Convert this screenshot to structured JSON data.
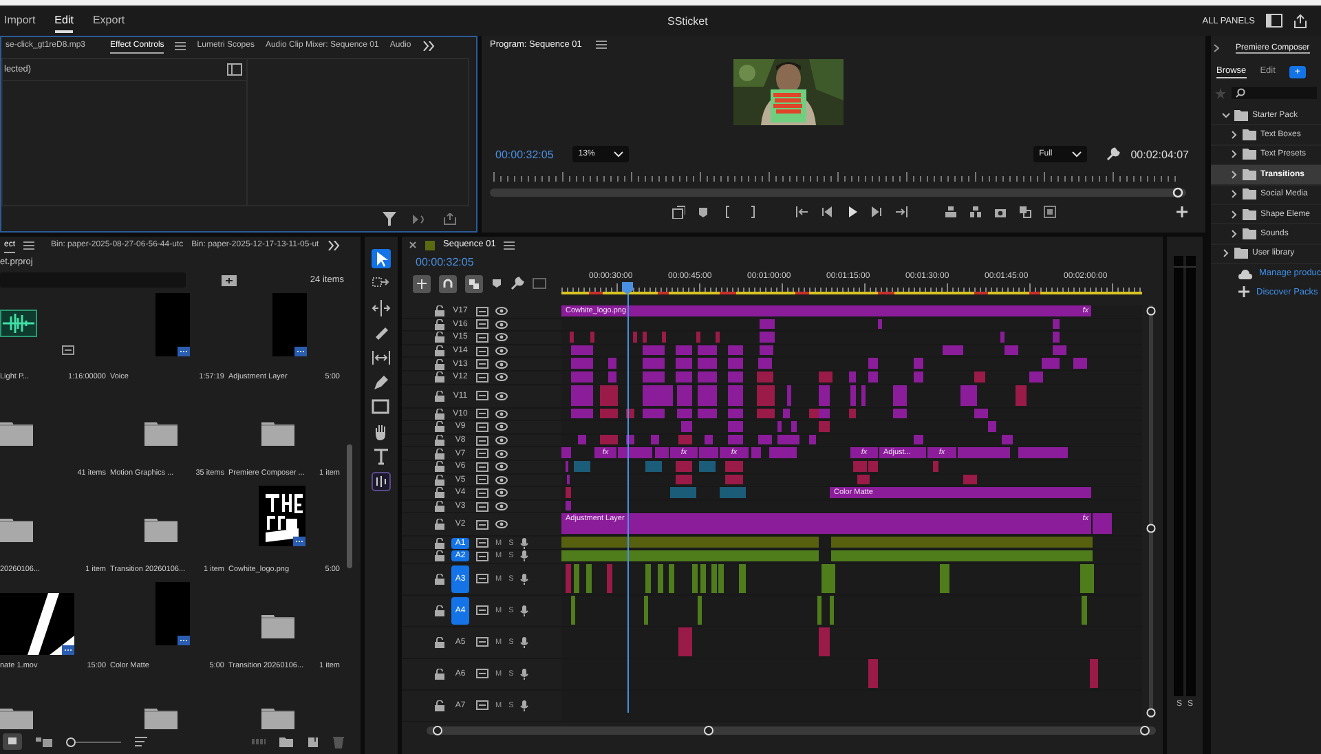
{
  "header": {
    "tabs": [
      {
        "label": "Import",
        "selected": false
      },
      {
        "label": "Edit",
        "selected": true
      },
      {
        "label": "Export",
        "selected": false
      }
    ],
    "title": "SSticket",
    "all_panels": "ALL PANELS"
  },
  "effect_panel": {
    "tabs": [
      {
        "label": "se-click_gt1reD8.mp3",
        "selected": false
      },
      {
        "label": "Effect Controls",
        "selected": true
      },
      {
        "label": "Lumetri Scopes",
        "selected": false
      },
      {
        "label": "Audio Clip Mixer: Sequence 01",
        "selected": false
      },
      {
        "label": "Audio",
        "selected": false
      }
    ],
    "clip_label": "lected)"
  },
  "program": {
    "title": "Program: Sequence 01",
    "timecode": "00:00:32:05",
    "zoom": "13%",
    "quality": "Full",
    "duration": "00:02:04:07"
  },
  "project": {
    "tabs": [
      {
        "label": "ect",
        "selected": true
      },
      {
        "label": "Bin: paper-2025-08-27-06-56-44-utc",
        "selected": false
      },
      {
        "label": "Bin: paper-2025-12-17-13-11-05-ut",
        "selected": false
      }
    ],
    "file": "et.prproj",
    "count": "24 items",
    "zoom_slider": {
      "level": 0
    },
    "items": [
      {
        "kind": "audio",
        "name": "Light P...",
        "info": "1:16:00000"
      },
      {
        "kind": "black",
        "name": "Voice",
        "info": "1:57:19"
      },
      {
        "kind": "black",
        "name": "Adjustment Layer",
        "info": "5:00"
      },
      {
        "kind": "folder",
        "info": "41 items"
      },
      {
        "kind": "folder",
        "name": "Motion Graphics ...",
        "info": "35 items"
      },
      {
        "kind": "folder",
        "name": "Premiere Composer ...",
        "info": "1 item"
      },
      {
        "kind": "folder",
        "name": "20260106...",
        "info": "1 item"
      },
      {
        "kind": "folder",
        "name": "Transition 20260106...",
        "info": "1 item"
      },
      {
        "kind": "logo",
        "name": "Cowhite_logo.png",
        "info": "5:00"
      },
      {
        "kind": "stroke",
        "name": "nate 1.mov",
        "info": "15:00"
      },
      {
        "kind": "black",
        "name": "Color Matte",
        "info": "5:00"
      },
      {
        "kind": "folder",
        "name": "Transition 20260106...",
        "info": "1 item"
      },
      {
        "kind": "folder"
      },
      {
        "kind": "folder"
      },
      {
        "kind": "folder"
      }
    ]
  },
  "timeline": {
    "title": "Sequence 01",
    "timecode": "00:00:32:05",
    "ruler": [
      "00:00:30:00",
      "00:00:45:00",
      "00:01:00:00",
      "00:01:15:00",
      "00:01:30:00",
      "00:01:45:00",
      "00:02:00:00"
    ],
    "tracks": [
      {
        "kind": "video",
        "name": "V17",
        "targeted": false,
        "expanded": false,
        "clips": [
          {
            "color": "#8b1d9a",
            "label": "Cowhite_logo.png",
            "badge": "fx"
          }
        ]
      },
      {
        "kind": "video",
        "name": "V16",
        "targeted": false,
        "expanded": false,
        "clips": [
          {
            "color": "#8b1d9a"
          },
          {
            "color": "#8b1d9a"
          },
          {
            "color": "#8b1d9a"
          }
        ]
      },
      {
        "kind": "video",
        "name": "V15",
        "targeted": false,
        "expanded": false,
        "clips": [
          {
            "color": "#9a1a48"
          },
          {
            "color": "#9a1a48"
          },
          {
            "color": "#9a1a48"
          },
          {
            "color": "#9a1a48"
          },
          {
            "color": "#9a1a48"
          },
          {
            "color": "#9a1a48"
          },
          {
            "color": "#9a1a48"
          },
          {
            "color": "#8b1d9a"
          },
          {
            "color": "#8b1d9a"
          },
          {
            "color": "#8b1d9a"
          }
        ]
      },
      {
        "kind": "video",
        "name": "V14",
        "targeted": false,
        "expanded": false,
        "clips": [
          {
            "color": "#8b1d9a"
          },
          {
            "color": "#8b1d9a"
          },
          {
            "color": "#8b1d9a"
          },
          {
            "color": "#8b1d9a"
          },
          {
            "color": "#8b1d9a"
          },
          {
            "color": "#8b1d9a"
          },
          {
            "color": "#8b1d9a"
          },
          {
            "color": "#8b1d9a"
          },
          {
            "color": "#8b1d9a"
          }
        ]
      },
      {
        "kind": "video",
        "name": "V13",
        "targeted": false,
        "expanded": false,
        "clips": [
          {
            "color": "#8b1d9a"
          },
          {
            "color": "#8b1d9a"
          },
          {
            "color": "#8b1d9a"
          },
          {
            "color": "#8b1d9a"
          },
          {
            "color": "#8b1d9a"
          },
          {
            "color": "#8b1d9a"
          },
          {
            "color": "#8b1d9a"
          },
          {
            "color": "#8b1d9a"
          },
          {
            "color": "#8b1d9a"
          },
          {
            "color": "#8b1d9a"
          },
          {
            "color": "#8b1d9a"
          }
        ]
      },
      {
        "kind": "video",
        "name": "V12",
        "targeted": false,
        "expanded": false,
        "clips": [
          {
            "color": "#8b1d9a"
          },
          {
            "color": "#8b1d9a"
          },
          {
            "color": "#8b1d9a"
          },
          {
            "color": "#8b1d9a"
          },
          {
            "color": "#8b1d9a"
          },
          {
            "color": "#8b1d9a"
          },
          {
            "color": "#9a1a48"
          },
          {
            "color": "#9a1a48"
          },
          {
            "color": "#8b1d9a"
          },
          {
            "color": "#8b1d9a"
          },
          {
            "color": "#8b1d9a"
          },
          {
            "color": "#9a1a48"
          },
          {
            "color": "#8b1d9a"
          }
        ]
      },
      {
        "kind": "video",
        "name": "V11",
        "targeted": false,
        "expanded": true,
        "clips": [
          {
            "color": "#8b1d9a"
          },
          {
            "color": "#9a1a48"
          },
          {
            "color": "#8b1d9a"
          },
          {
            "color": "#8b1d9a"
          },
          {
            "color": "#8b1d9a"
          },
          {
            "color": "#8b1d9a"
          },
          {
            "color": "#8b1d9a"
          },
          {
            "color": "#9a1a48"
          },
          {
            "color": "#8b1d9a"
          },
          {
            "color": "#8b1d9a"
          },
          {
            "color": "#8b1d9a"
          },
          {
            "color": "#8b1d9a"
          },
          {
            "color": "#8b1d9a"
          },
          {
            "color": "#8b1d9a"
          },
          {
            "color": "#9a1a48"
          }
        ]
      },
      {
        "kind": "video",
        "name": "V10",
        "targeted": false,
        "expanded": false,
        "clips": [
          {
            "color": "#8b1d9a"
          },
          {
            "color": "#9a1a48"
          },
          {
            "color": "#9a1a48"
          },
          {
            "color": "#8b1d9a"
          },
          {
            "color": "#8b1d9a"
          },
          {
            "color": "#8b1d9a"
          },
          {
            "color": "#8b1d9a"
          },
          {
            "color": "#9a1a48"
          },
          {
            "color": "#8b1d9a"
          },
          {
            "color": "#9a1a48"
          },
          {
            "color": "#8b1d9a"
          },
          {
            "color": "#9a1a48"
          },
          {
            "color": "#8b1d9a"
          },
          {
            "color": "#8b1d9a"
          }
        ]
      },
      {
        "kind": "video",
        "name": "V9",
        "targeted": false,
        "expanded": false,
        "clips": [
          {
            "color": "#8b1d9a"
          },
          {
            "color": "#8b1d9a"
          },
          {
            "color": "#8b1d9a"
          },
          {
            "color": "#8b1d9a"
          },
          {
            "color": "#9a1a48"
          },
          {
            "color": "#8b1d9a"
          }
        ]
      },
      {
        "kind": "video",
        "name": "V8",
        "targeted": false,
        "expanded": false,
        "clips": [
          {
            "color": "#8b1d9a"
          },
          {
            "color": "#9a1a48"
          },
          {
            "color": "#8b1d9a"
          },
          {
            "color": "#8b1d9a"
          },
          {
            "color": "#9a1a48"
          },
          {
            "color": "#8b1d9a"
          },
          {
            "color": "#8b1d9a"
          },
          {
            "color": "#8b1d9a"
          },
          {
            "color": "#8b1d9a"
          },
          {
            "color": "#8b1d9a"
          },
          {
            "color": "#8b1d9a"
          },
          {
            "color": "#8b1d9a"
          }
        ]
      },
      {
        "kind": "video",
        "name": "V7",
        "targeted": false,
        "expanded": false,
        "clips": [
          {
            "color": "#8b1d9a"
          },
          {
            "color": "#8b1d9a",
            "badge": "fx"
          },
          {
            "color": "#8b1d9a"
          },
          {
            "color": "#8b1d9a"
          },
          {
            "color": "#8b1d9a"
          },
          {
            "color": "#8b1d9a",
            "badge": "fx"
          },
          {
            "color": "#8b1d9a"
          },
          {
            "color": "#8b1d9a",
            "badge": "fx"
          },
          {
            "color": "#8b1d9a"
          },
          {
            "color": "#8b1d9a"
          },
          {
            "color": "#8b1d9a",
            "badge": "fx"
          },
          {
            "color": "#8b1d9a",
            "label": "Adjust..."
          },
          {
            "color": "#8b1d9a",
            "badge": "fx"
          },
          {
            "color": "#8b1d9a"
          },
          {
            "color": "#8b1d9a"
          }
        ]
      },
      {
        "kind": "video",
        "name": "V6",
        "targeted": false,
        "expanded": false,
        "clips": [
          {
            "color": "#8b1d9a"
          },
          {
            "color": "#1b5c78"
          },
          {
            "color": "#1b5c78"
          },
          {
            "color": "#9a1a48"
          },
          {
            "color": "#1b5c78"
          },
          {
            "color": "#9a1a48"
          },
          {
            "color": "#9a1a48"
          },
          {
            "color": "#9a1a48"
          },
          {
            "color": "#9a1a48"
          }
        ]
      },
      {
        "kind": "video",
        "name": "V5",
        "targeted": false,
        "expanded": false,
        "clips": [
          {
            "color": "#8b1d9a"
          },
          {
            "color": "#9a1a48"
          },
          {
            "color": "#9a1a48"
          },
          {
            "color": "#9a1a48"
          },
          {
            "color": "#9a1a48"
          }
        ]
      },
      {
        "kind": "video",
        "name": "V4",
        "targeted": false,
        "expanded": false,
        "clips": [
          {
            "color": "#9a1a48"
          },
          {
            "color": "#1b5c78"
          },
          {
            "color": "#1b5c78"
          },
          {
            "color": "#8b1d9a",
            "label": "Color Matte"
          }
        ]
      },
      {
        "kind": "video",
        "name": "V3",
        "targeted": false,
        "expanded": false,
        "clips": [
          {
            "color": "#8b1d9a"
          }
        ]
      },
      {
        "kind": "video",
        "name": "V2",
        "targeted": false,
        "expanded": true,
        "clips": [
          {
            "color": "#8b1d9a",
            "label": "Adjustment Layer",
            "badge": "fx"
          },
          {
            "color": "#8b1d9a"
          }
        ]
      },
      {
        "kind": "audio",
        "name": "A1",
        "targeted": true,
        "expanded": false,
        "mute": "M",
        "solo": "S",
        "clips": [
          {
            "color": "#56600f"
          },
          {
            "color": "#56600f"
          }
        ]
      },
      {
        "kind": "audio",
        "name": "A2",
        "targeted": true,
        "expanded": false,
        "mute": "M",
        "solo": "S",
        "clips": [
          {
            "color": "#4f7d1c"
          },
          {
            "color": "#4f7d1c"
          }
        ]
      },
      {
        "kind": "audio",
        "name": "A3",
        "targeted": true,
        "expanded": true,
        "mute": "M",
        "solo": "S",
        "clips": [
          {
            "color": "#9a1a48"
          },
          {
            "color": "#4f7d1c"
          },
          {
            "color": "#4f7d1c"
          },
          {
            "color": "#9a1a48"
          },
          {
            "color": "#4f7d1c"
          },
          {
            "color": "#4f7d1c"
          },
          {
            "color": "#4f7d1c"
          },
          {
            "color": "#4f7d1c"
          },
          {
            "color": "#4f7d1c"
          },
          {
            "color": "#4f7d1c"
          },
          {
            "color": "#4f7d1c"
          },
          {
            "color": "#4f7d1c"
          },
          {
            "color": "#4f7d1c"
          },
          {
            "color": "#4f7d1c"
          },
          {
            "color": "#4f7d1c"
          }
        ]
      },
      {
        "kind": "audio",
        "name": "A4",
        "targeted": true,
        "expanded": true,
        "mute": "M",
        "solo": "S",
        "clips": [
          {
            "color": "#4f7d1c"
          },
          {
            "color": "#4f7d1c"
          },
          {
            "color": "#4f7d1c"
          },
          {
            "color": "#4f7d1c"
          },
          {
            "color": "#4f7d1c"
          },
          {
            "color": "#4f7d1c"
          }
        ]
      },
      {
        "kind": "audio",
        "name": "A5",
        "targeted": false,
        "expanded": true,
        "mute": "M",
        "solo": "S",
        "clips": [
          {
            "color": "#9a1a48"
          },
          {
            "color": "#9a1a48"
          }
        ]
      },
      {
        "kind": "audio",
        "name": "A6",
        "targeted": false,
        "expanded": true,
        "mute": "M",
        "solo": "S",
        "clips": [
          {
            "color": "#9a1a48"
          },
          {
            "color": "#9a1a48"
          }
        ]
      },
      {
        "kind": "audio",
        "name": "A7",
        "targeted": false,
        "expanded": true,
        "mute": "M",
        "solo": "S"
      }
    ]
  },
  "meters": {
    "labels": [
      "S",
      "S"
    ]
  },
  "composer": {
    "title": "Premiere Composer",
    "tabs": [
      {
        "label": "Browse",
        "selected": true
      },
      {
        "label": "Edit",
        "selected": false
      }
    ],
    "add_button": "+",
    "tree": [
      {
        "label": "Starter Pack",
        "expanded": true,
        "selected": false,
        "children": [
          {
            "label": "Text Boxes",
            "expanded": false,
            "selected": false
          },
          {
            "label": "Text Presets",
            "expanded": false,
            "selected": false
          },
          {
            "label": "Transitions",
            "expanded": false,
            "selected": true
          },
          {
            "label": "Social Media",
            "expanded": false,
            "selected": false
          },
          {
            "label": "Shape Eleme",
            "expanded": false,
            "selected": false
          },
          {
            "label": "Sounds",
            "expanded": false,
            "selected": false
          }
        ]
      },
      {
        "label": "User library",
        "expanded": false,
        "selected": false
      }
    ],
    "links": [
      "Manage produc",
      "Discover Packs"
    ]
  }
}
